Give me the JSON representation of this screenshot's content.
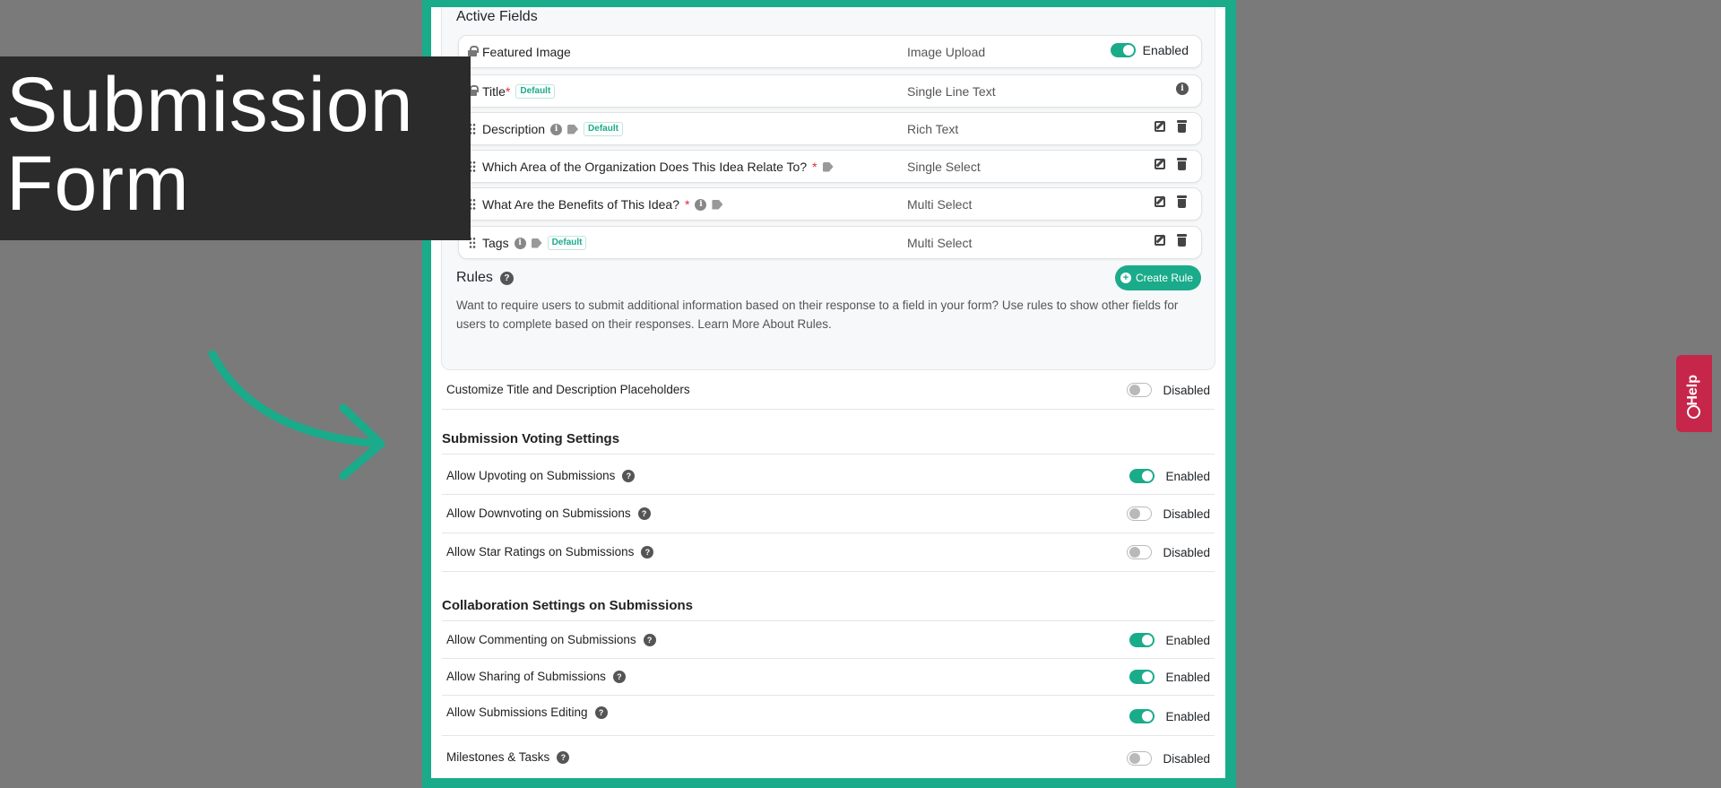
{
  "overlay": {
    "title_line1": "Submission",
    "title_line2": "Form"
  },
  "active_fields": {
    "title": "Active Fields",
    "default_badge": "Default",
    "fields": [
      {
        "name": "Featured Image",
        "type": "Image Upload",
        "status": "Enabled",
        "required_mark": ""
      },
      {
        "name": "Title",
        "type": "Single Line Text",
        "required_mark": "*"
      },
      {
        "name": "Description",
        "type": "Rich Text"
      },
      {
        "name": "Which Area of the Organization Does This Idea Relate To?",
        "type": "Single Select",
        "required_mark": "*"
      },
      {
        "name": "What Are the Benefits of This Idea?",
        "type": "Multi Select",
        "required_mark": "*"
      },
      {
        "name": "Tags",
        "type": "Multi Select"
      }
    ]
  },
  "rules": {
    "title": "Rules",
    "create_button": "Create Rule",
    "description": "Want to require users to submit additional information based on their response to a field in your form? Use rules to show other fields for users to complete based on their responses. Learn More About Rules."
  },
  "placeholders_row": {
    "label": "Customize Title and Description Placeholders",
    "status": "Disabled"
  },
  "voting": {
    "heading": "Submission Voting Settings",
    "rows": [
      {
        "label": "Allow Upvoting on Submissions",
        "status": "Enabled"
      },
      {
        "label": "Allow Downvoting on Submissions",
        "status": "Disabled"
      },
      {
        "label": "Allow Star Ratings on Submissions",
        "status": "Disabled"
      }
    ]
  },
  "collaboration": {
    "heading": "Collaboration Settings on Submissions",
    "rows": [
      {
        "label": "Allow Commenting on Submissions",
        "status": "Enabled"
      },
      {
        "label": "Allow Sharing of Submissions",
        "status": "Enabled"
      },
      {
        "label": "Allow Submissions Editing",
        "status": "Enabled"
      },
      {
        "label": "Milestones & Tasks",
        "status": "Disabled"
      }
    ]
  },
  "help_tab": {
    "label": "Help"
  },
  "colors": {
    "accent": "#1aab8b",
    "help": "#c7264b",
    "overlay": "#2b2b2b"
  }
}
